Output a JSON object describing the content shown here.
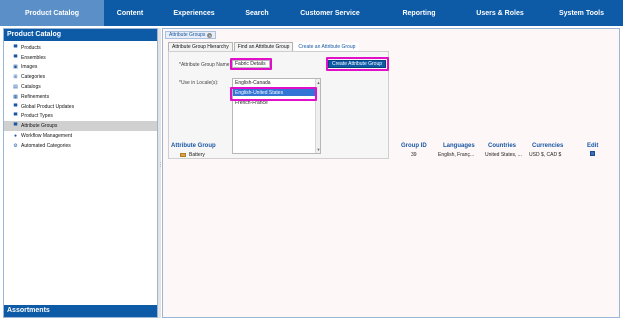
{
  "top_nav": {
    "tabs": [
      {
        "label": "Product Catalog",
        "active": true
      },
      {
        "label": "Content"
      },
      {
        "label": "Experiences"
      },
      {
        "label": "Search"
      },
      {
        "label": "Customer Service"
      },
      {
        "label": "Reporting"
      },
      {
        "label": "Users & Roles"
      },
      {
        "label": "System Tools"
      }
    ]
  },
  "sidebar": {
    "title": "Product Catalog",
    "items": [
      {
        "label": "Products",
        "icon": "shirt-icon"
      },
      {
        "label": "Ensembles",
        "icon": "shirt-icon"
      },
      {
        "label": "Images",
        "icon": "image-icon"
      },
      {
        "label": "Categories",
        "icon": "category-icon"
      },
      {
        "label": "Catalogs",
        "icon": "catalog-icon"
      },
      {
        "label": "Refinements",
        "icon": "refinement-icon"
      },
      {
        "label": "Global Product Updates",
        "icon": "shirt-icon"
      },
      {
        "label": "Product Types",
        "icon": "shirt-icon"
      },
      {
        "label": "Attribute Groups",
        "icon": "shirt-icon",
        "selected": true
      },
      {
        "label": "Workflow Management",
        "icon": "info-icon"
      },
      {
        "label": "Automated Categories",
        "icon": "gear-icon"
      }
    ],
    "footer": "Assortments"
  },
  "main": {
    "tab_label": "Attribute Groups",
    "subtabs": [
      {
        "label": "Attribute Group Hierarchy"
      },
      {
        "label": "Find an Attribute Group"
      },
      {
        "label": "Create an Attribute Group",
        "active": true
      }
    ],
    "form": {
      "name_label": "*Attribute Group Name:",
      "name_value": "Fabric Details",
      "create_button": "Create Attribute Group",
      "locale_label": "*Use in Locale(s):",
      "locale_options": [
        {
          "label": "English-Canada"
        },
        {
          "label": "English-United States",
          "selected": true
        },
        {
          "label": "French-France"
        }
      ]
    },
    "table": {
      "headers": [
        "Attribute Group",
        "Group ID",
        "Languages",
        "Countries",
        "Currencies",
        "Edit"
      ],
      "rows": [
        {
          "name": "Battery",
          "group_id": "39",
          "languages": "English, Franç...",
          "countries": "United States, ...",
          "currencies": "USD $, CAD $"
        }
      ]
    }
  },
  "colors": {
    "nav_blue": "#0d5aa7",
    "highlight_magenta": "#e10fc8"
  }
}
